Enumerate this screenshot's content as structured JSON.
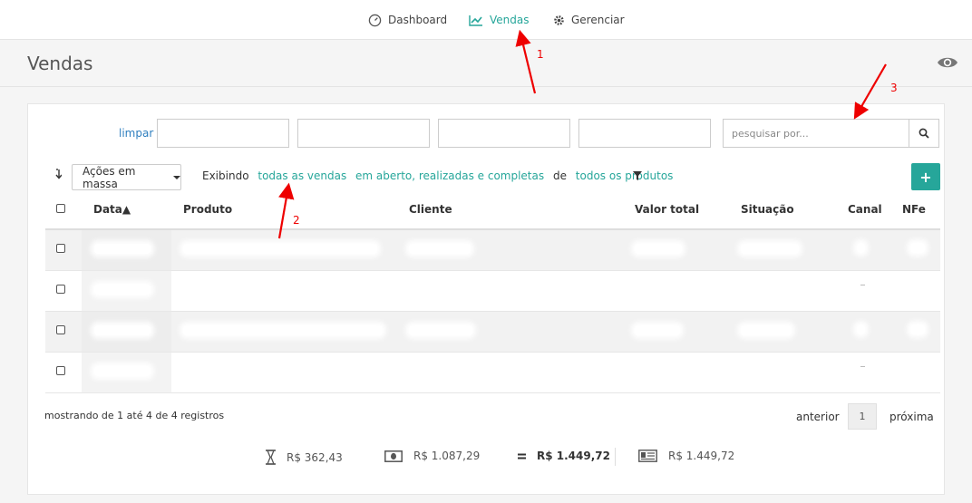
{
  "nav": {
    "dashboard": "Dashboard",
    "vendas": "Vendas",
    "gerenciar": "Gerenciar",
    "active_color": "#26a69a"
  },
  "page": {
    "title": "Vendas"
  },
  "filters": {
    "limpar": "limpar",
    "search_placeholder": "pesquisar por..."
  },
  "toolbar": {
    "mass_actions": "Ações em massa",
    "exibindo": "Exibindo",
    "filter_vendas": "todas as vendas",
    "filter_status": "em aberto, realizadas e completas",
    "de": "de",
    "filter_produtos": "todos os produtos",
    "add_label": "+"
  },
  "table": {
    "columns": [
      "Data▲",
      "Produto",
      "Cliente",
      "Valor total",
      "Situação",
      "Canal",
      "NFe"
    ],
    "rows_count_visible": 4
  },
  "footer": {
    "showing": "mostrando de 1 até 4 de 4 registros",
    "prev": "anterior",
    "page": "1",
    "next": "próxima"
  },
  "totals": {
    "pending": "R$ 362,43",
    "received": "R$ 1.087,29",
    "total": "R$ 1.449,72",
    "invoiced": "R$ 1.449,72"
  },
  "annotations": {
    "a1": "1",
    "a2": "2",
    "a3": "3"
  },
  "icons": [
    "dashboard-icon",
    "chart-line-icon",
    "gear-icon",
    "eye-icon",
    "search-icon",
    "sort-icon",
    "filter-icon",
    "hourglass-icon",
    "money-icon",
    "equals-icon",
    "receipt-icon"
  ]
}
